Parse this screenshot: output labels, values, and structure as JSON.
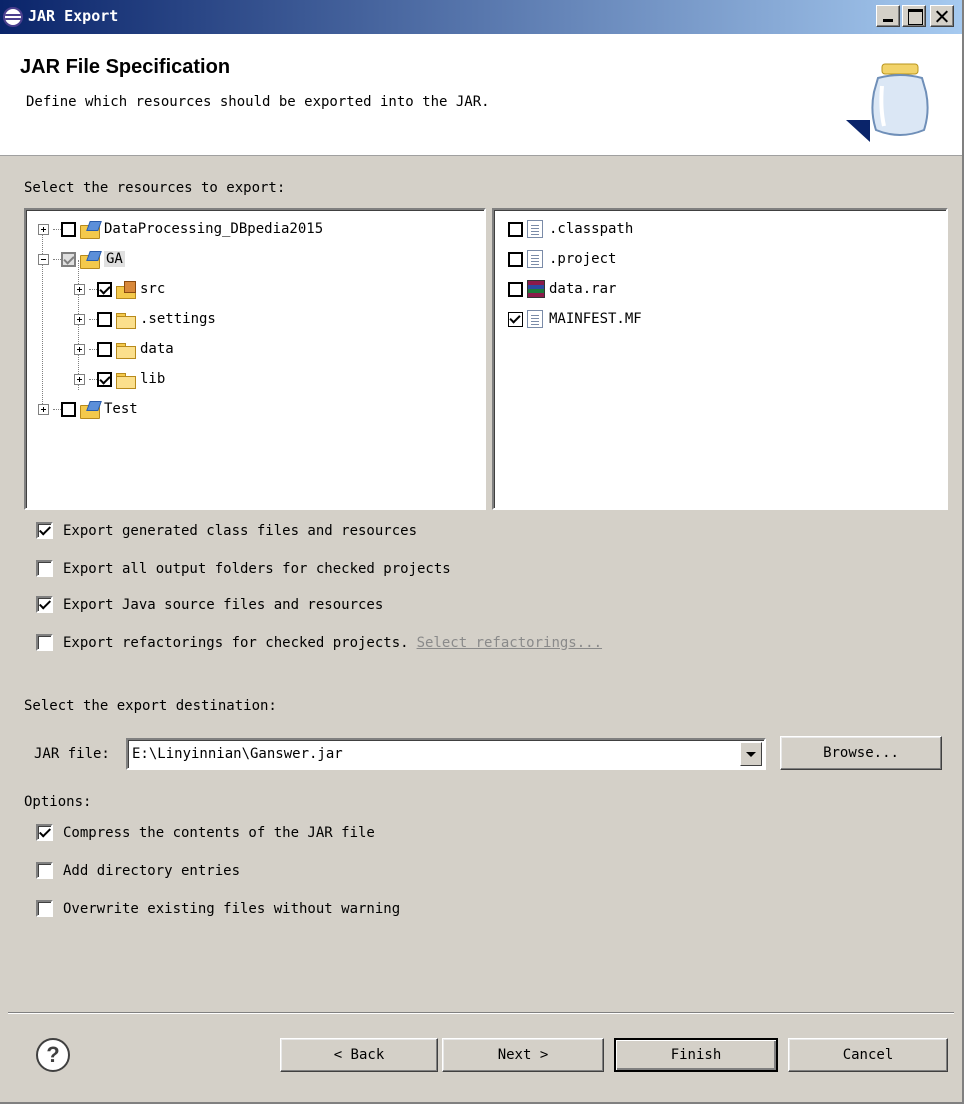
{
  "window": {
    "title": "JAR Export"
  },
  "header": {
    "title": "JAR File Specification",
    "description": "Define which resources should be exported into the JAR."
  },
  "resources": {
    "label": "Select the resources to export:",
    "tree": [
      {
        "label": "DataProcessing_DBpedia2015",
        "state": "unchecked",
        "icon": "project-icon"
      },
      {
        "label": "GA",
        "state": "partial",
        "icon": "project-icon",
        "selected": true
      },
      {
        "label": "src",
        "state": "checked",
        "icon": "package-icon"
      },
      {
        "label": ".settings",
        "state": "unchecked",
        "icon": "folder-icon"
      },
      {
        "label": "data",
        "state": "unchecked",
        "icon": "folder-icon"
      },
      {
        "label": "lib",
        "state": "checked",
        "icon": "folder-icon"
      },
      {
        "label": "Test",
        "state": "unchecked",
        "icon": "project-icon"
      }
    ],
    "files": [
      {
        "label": ".classpath",
        "state": "unchecked",
        "icon": "file-icon"
      },
      {
        "label": ".project",
        "state": "unchecked",
        "icon": "file-icon"
      },
      {
        "label": "data.rar",
        "state": "unchecked",
        "icon": "rar-archive-icon"
      },
      {
        "label": "MAINFEST.MF",
        "state": "checked",
        "icon": "file-icon"
      }
    ]
  },
  "export_options": [
    {
      "label": "Export generated class files and resources",
      "checked": true
    },
    {
      "label": "Export all output folders for checked projects",
      "checked": false
    },
    {
      "label": "Export Java source files and resources",
      "checked": true
    },
    {
      "label": "Export refactorings for checked projects.",
      "checked": false,
      "link": "Select refactorings..."
    }
  ],
  "destination": {
    "label": "Select the export destination:",
    "jar_label": "JAR file:",
    "jar_value": "E:\\Linyinnian\\Ganswer.jar",
    "browse": "Browse..."
  },
  "options": {
    "label": "Options:",
    "items": [
      {
        "label": "Compress the contents of the JAR file",
        "checked": true
      },
      {
        "label": "Add directory entries",
        "checked": false
      },
      {
        "label": "Overwrite existing files without warning",
        "checked": false
      }
    ]
  },
  "footer": {
    "help": "?",
    "back": "< Back",
    "next": "Next >",
    "finish": "Finish",
    "cancel": "Cancel"
  }
}
